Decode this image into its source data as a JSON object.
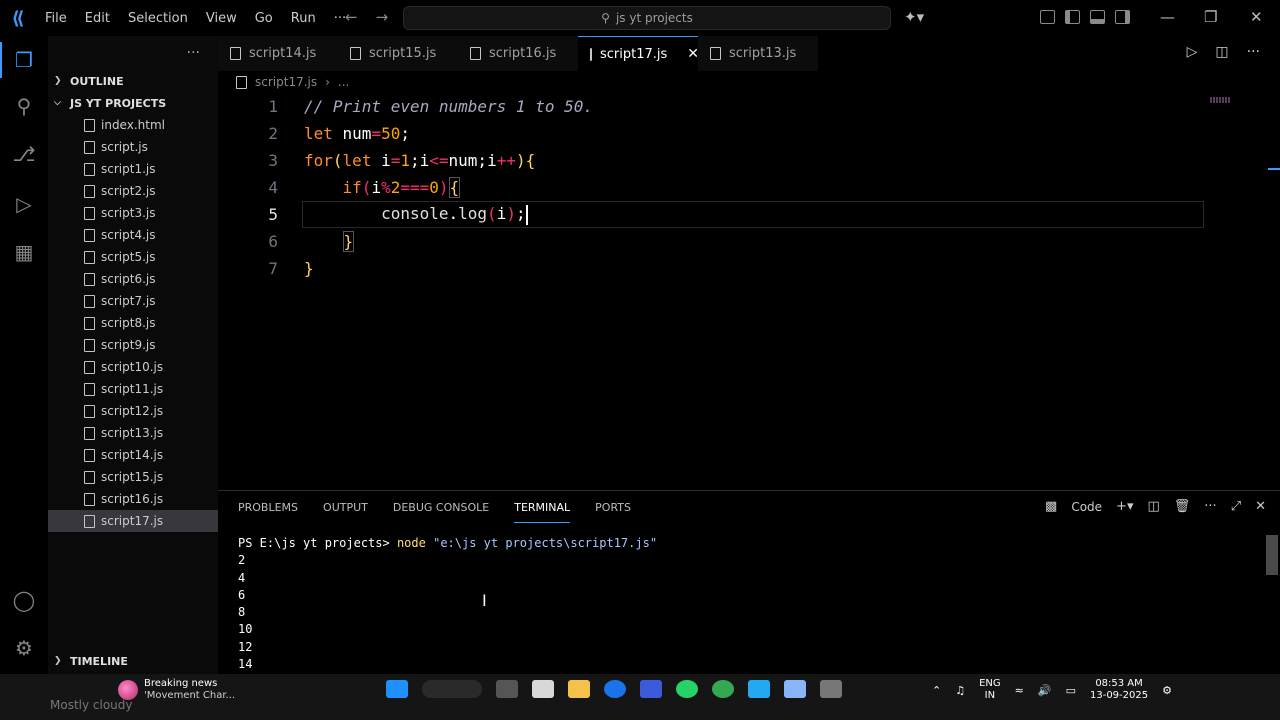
{
  "titlebar": {
    "menu": [
      "File",
      "Edit",
      "Selection",
      "View",
      "Go",
      "Run",
      "···"
    ],
    "search_text": "js yt projects"
  },
  "sidebar": {
    "outline_label": "OUTLINE",
    "project_label": "JS YT PROJECTS",
    "files": [
      "index.html",
      "script.js",
      "script1.js",
      "script2.js",
      "script3.js",
      "script4.js",
      "script5.js",
      "script6.js",
      "script7.js",
      "script8.js",
      "script9.js",
      "script10.js",
      "script11.js",
      "script12.js",
      "script13.js",
      "script14.js",
      "script15.js",
      "script16.js",
      "script17.js"
    ],
    "selected_file": "script17.js",
    "timeline_label": "TIMELINE"
  },
  "tabs": [
    {
      "label": "script14.js",
      "active": false
    },
    {
      "label": "script15.js",
      "active": false
    },
    {
      "label": "script16.js",
      "active": false
    },
    {
      "label": "script17.js",
      "active": true
    },
    {
      "label": "script13.js",
      "active": false
    }
  ],
  "breadcrumb": {
    "file": "script17.js",
    "more": "..."
  },
  "editor": {
    "line_numbers": [
      "1",
      "2",
      "3",
      "4",
      "5",
      "6",
      "7"
    ],
    "current_line": 5,
    "code_lines": [
      "// Print even numbers 1 to 50.",
      "let num=50;",
      "for(let i=1;i<=num;i++){",
      "    if(i%2===0){",
      "        console.log(i);",
      "    }",
      "}"
    ]
  },
  "panel": {
    "tabs": [
      "PROBLEMS",
      "OUTPUT",
      "DEBUG CONSOLE",
      "TERMINAL",
      "PORTS"
    ],
    "active_tab": "TERMINAL",
    "shell_label": "Code",
    "terminal": {
      "prompt": "PS E:\\js yt projects>",
      "command": "node",
      "arg": "\"e:\\js yt projects\\script17.js\"",
      "output": [
        "2",
        "4",
        "6",
        "8",
        "10",
        "12",
        "14"
      ]
    }
  },
  "taskbar": {
    "weather_title": "Breaking news",
    "weather_sub": "'Movement Char...",
    "weather_ghost": "Mostly cloudy",
    "lang_top": "ENG",
    "lang_bottom": "IN",
    "time": "08:53 AM",
    "date": "13-09-2025"
  },
  "colors": {
    "accent": "#3c9bff",
    "keyword": "#ff8c2b",
    "operator": "#f5306a",
    "number": "#ffa600",
    "brace": "#ffd75e"
  }
}
